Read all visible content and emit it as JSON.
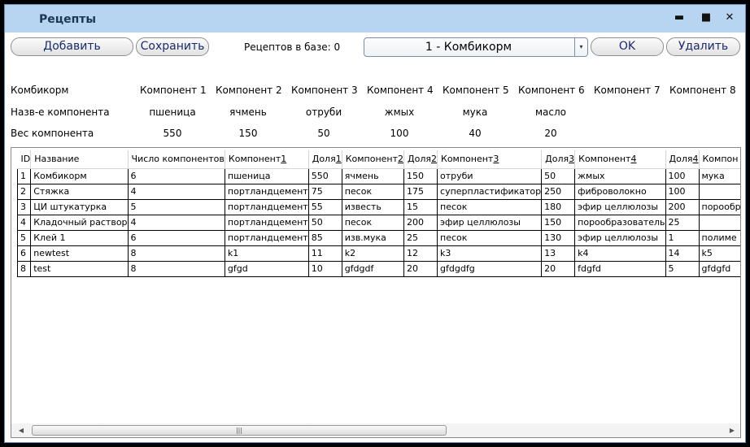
{
  "window": {
    "title": "Рецепты",
    "controls": {
      "minimize": "▬",
      "maximize": "■",
      "close": "✕"
    }
  },
  "toolbar": {
    "add_label": "Добавить",
    "save_label": "Сохранить",
    "recipes_count": "Рецептов в базе: 0",
    "selected_recipe": "1 - Комбикорм",
    "dropdown_icon": "▾",
    "ok_label": "OK",
    "delete_label": "Удалить"
  },
  "details": {
    "recipe_label": "Комбикорм",
    "component_headers": [
      "Компонент 1",
      "Компонент 2",
      "Компонент 3",
      "Компонент 4",
      "Компонент 5",
      "Компонент 6",
      "Компонент 7",
      "Компонент 8"
    ],
    "name_label": "Назв-е компонента",
    "names": [
      "пшеница",
      "ячмень",
      "отруби",
      "жмых",
      "мука",
      "масло",
      "",
      ""
    ],
    "weight_label": "Вес компонента",
    "weights": [
      "550",
      "150",
      "50",
      "100",
      "40",
      "20",
      "",
      ""
    ]
  },
  "grid": {
    "columns": [
      "ID",
      "Название",
      "Число компонентов",
      "Компонент1",
      "Доля1",
      "Компонент2",
      "Доля2",
      "Компонент3",
      "Доля3",
      "Компонент4",
      "Доля4",
      "Компон"
    ],
    "rows": [
      [
        "1",
        "Комбикорм",
        "6",
        "пшеница",
        "550",
        "ячмень",
        "150",
        "отруби",
        "50",
        "жмых",
        "100",
        "мука"
      ],
      [
        "2",
        "Стяжка",
        "4",
        "портландцемент",
        "75",
        "песок",
        "175",
        "суперпластификатор",
        "250",
        "фиброволокно",
        "100",
        ""
      ],
      [
        "3",
        "ЦИ штукатурка",
        "5",
        "портландцемент",
        "55",
        "известь",
        "15",
        "песок",
        "180",
        "эфир целлюлозы",
        "200",
        "порообр"
      ],
      [
        "4",
        "Кладочный раствор",
        "4",
        "портландцемент",
        "50",
        "песок",
        "200",
        "эфир целлюлозы",
        "150",
        "порообразователь",
        "25",
        ""
      ],
      [
        "5",
        "Клей 1",
        "6",
        "портландцемент",
        "85",
        "изв.мука",
        "25",
        "песок",
        "130",
        "эфир целлюлозы",
        "1",
        "полиме"
      ],
      [
        "6",
        "newtest",
        "8",
        "k1",
        "11",
        "k2",
        "12",
        "k3",
        "13",
        "k4",
        "14",
        "k5"
      ],
      [
        "8",
        "test",
        "8",
        "gfgd",
        "10",
        "gfdgdf",
        "20",
        "gfdgdfg",
        "20",
        "fdgfd",
        "5",
        "gfdgfd"
      ]
    ],
    "scroll": {
      "left_arrow": "◀",
      "right_arrow": "▶",
      "thumb_grip": "|||"
    }
  }
}
